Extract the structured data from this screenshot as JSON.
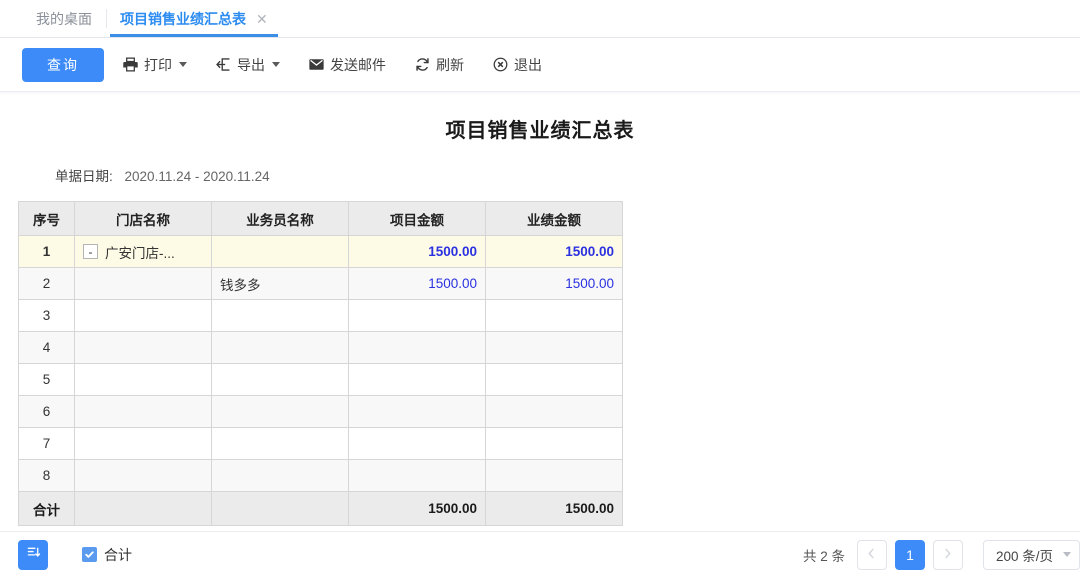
{
  "tabs": [
    {
      "label": "我的桌面",
      "active": false,
      "closable": false
    },
    {
      "label": "项目销售业绩汇总表",
      "active": true,
      "closable": true,
      "close_icon": "close-icon"
    }
  ],
  "toolbar": {
    "query_label": "查询",
    "items": [
      {
        "label": "打印",
        "icon": "printer-icon",
        "has_caret": true
      },
      {
        "label": "导出",
        "icon": "export-icon",
        "has_caret": true
      },
      {
        "label": "发送邮件",
        "icon": "mail-icon",
        "has_caret": false
      },
      {
        "label": "刷新",
        "icon": "refresh-icon",
        "has_caret": false
      },
      {
        "label": "退出",
        "icon": "exit-circle-icon",
        "has_caret": false
      }
    ]
  },
  "report": {
    "title": "项目销售业绩汇总表",
    "filter_label": "单据日期:",
    "filter_value": "2020.11.24 - 2020.11.24"
  },
  "table": {
    "headers": [
      "序号",
      "门店名称",
      "业务员名称",
      "项目金额",
      "业绩金额"
    ],
    "rows": [
      {
        "seq": "1",
        "expander": "-",
        "store": "广安门店-...",
        "staff": "",
        "project_amount": "1500.00",
        "performance_amount": "1500.00",
        "selected": true
      },
      {
        "seq": "2",
        "expander": "",
        "store": "",
        "staff": "钱多多",
        "project_amount": "1500.00",
        "performance_amount": "1500.00",
        "selected": false
      },
      {
        "seq": "3",
        "expander": "",
        "store": "",
        "staff": "",
        "project_amount": "",
        "performance_amount": "",
        "selected": false
      },
      {
        "seq": "4",
        "expander": "",
        "store": "",
        "staff": "",
        "project_amount": "",
        "performance_amount": "",
        "selected": false
      },
      {
        "seq": "5",
        "expander": "",
        "store": "",
        "staff": "",
        "project_amount": "",
        "performance_amount": "",
        "selected": false
      },
      {
        "seq": "6",
        "expander": "",
        "store": "",
        "staff": "",
        "project_amount": "",
        "performance_amount": "",
        "selected": false
      },
      {
        "seq": "7",
        "expander": "",
        "store": "",
        "staff": "",
        "project_amount": "",
        "performance_amount": "",
        "selected": false
      },
      {
        "seq": "8",
        "expander": "",
        "store": "",
        "staff": "",
        "project_amount": "",
        "performance_amount": "",
        "selected": false
      }
    ],
    "total_row": {
      "label": "合计",
      "store": "",
      "staff": "",
      "project_amount": "1500.00",
      "performance_amount": "1500.00"
    }
  },
  "footer": {
    "sum_button_icon": "summary-list-icon",
    "sum_checkbox_label": "合计",
    "sum_checkbox_checked": true,
    "pager": {
      "total_text": "共 2 条",
      "prev_icon": "chevron-left-icon",
      "next_icon": "chevron-right-icon",
      "prev_disabled": true,
      "next_disabled": true,
      "pages": [
        "1"
      ],
      "current_page": "1",
      "page_size_label": "200 条/页"
    }
  },
  "colors": {
    "accent": "#3d8bf8",
    "tab_active": "#2d8cf0",
    "amount": "#2b31e0",
    "selected_row": "#fdfae6",
    "header_bg": "#ebebeb"
  }
}
